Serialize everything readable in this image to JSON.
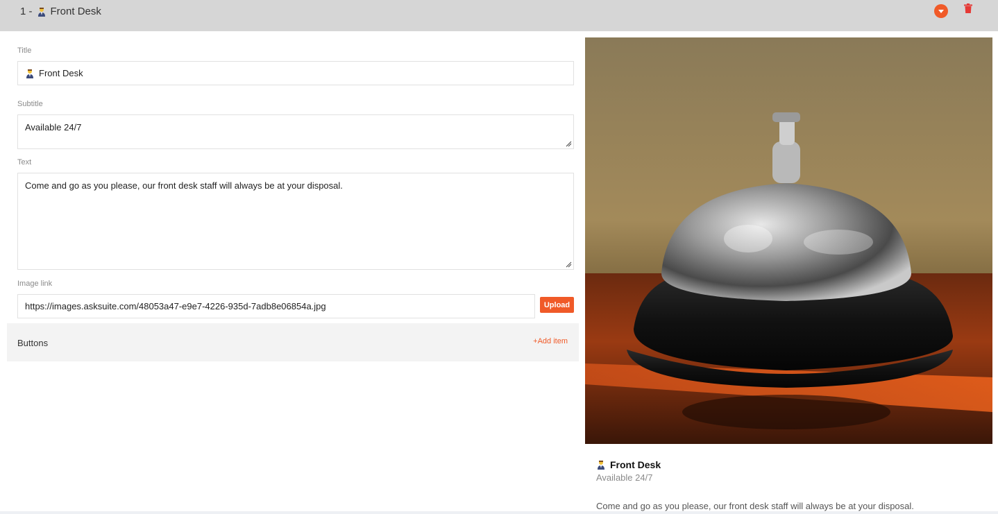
{
  "header": {
    "item_prefix": "1 -",
    "item_title": "Front Desk"
  },
  "form": {
    "title_label": "Title",
    "title_value": "Front Desk",
    "subtitle_label": "Subtitle",
    "subtitle_value": "Available 24/7",
    "text_label": "Text",
    "text_value": "Come and go as you please, our front desk staff will always be at your disposal.",
    "image_link_label": "Image link",
    "image_link_value": "https://images.asksuite.com/48053a47-e9e7-4226-935d-7adb8e06854a.jpg",
    "upload_label": "Upload"
  },
  "buttons_section": {
    "label": "Buttons",
    "add_label": "+Add item"
  },
  "preview": {
    "title": "Front Desk",
    "subtitle": "Available 24/7",
    "text": "Come and go as you please, our front desk staff will always be at your disposal."
  },
  "colors": {
    "accent": "#f05a28",
    "header_bg": "#d6d6d6",
    "section_bg": "#f3f3f3"
  },
  "icons": {
    "emoji": "person-office-worker-emoji",
    "collapse": "chevron-down-circle-icon",
    "delete": "trash-icon"
  }
}
